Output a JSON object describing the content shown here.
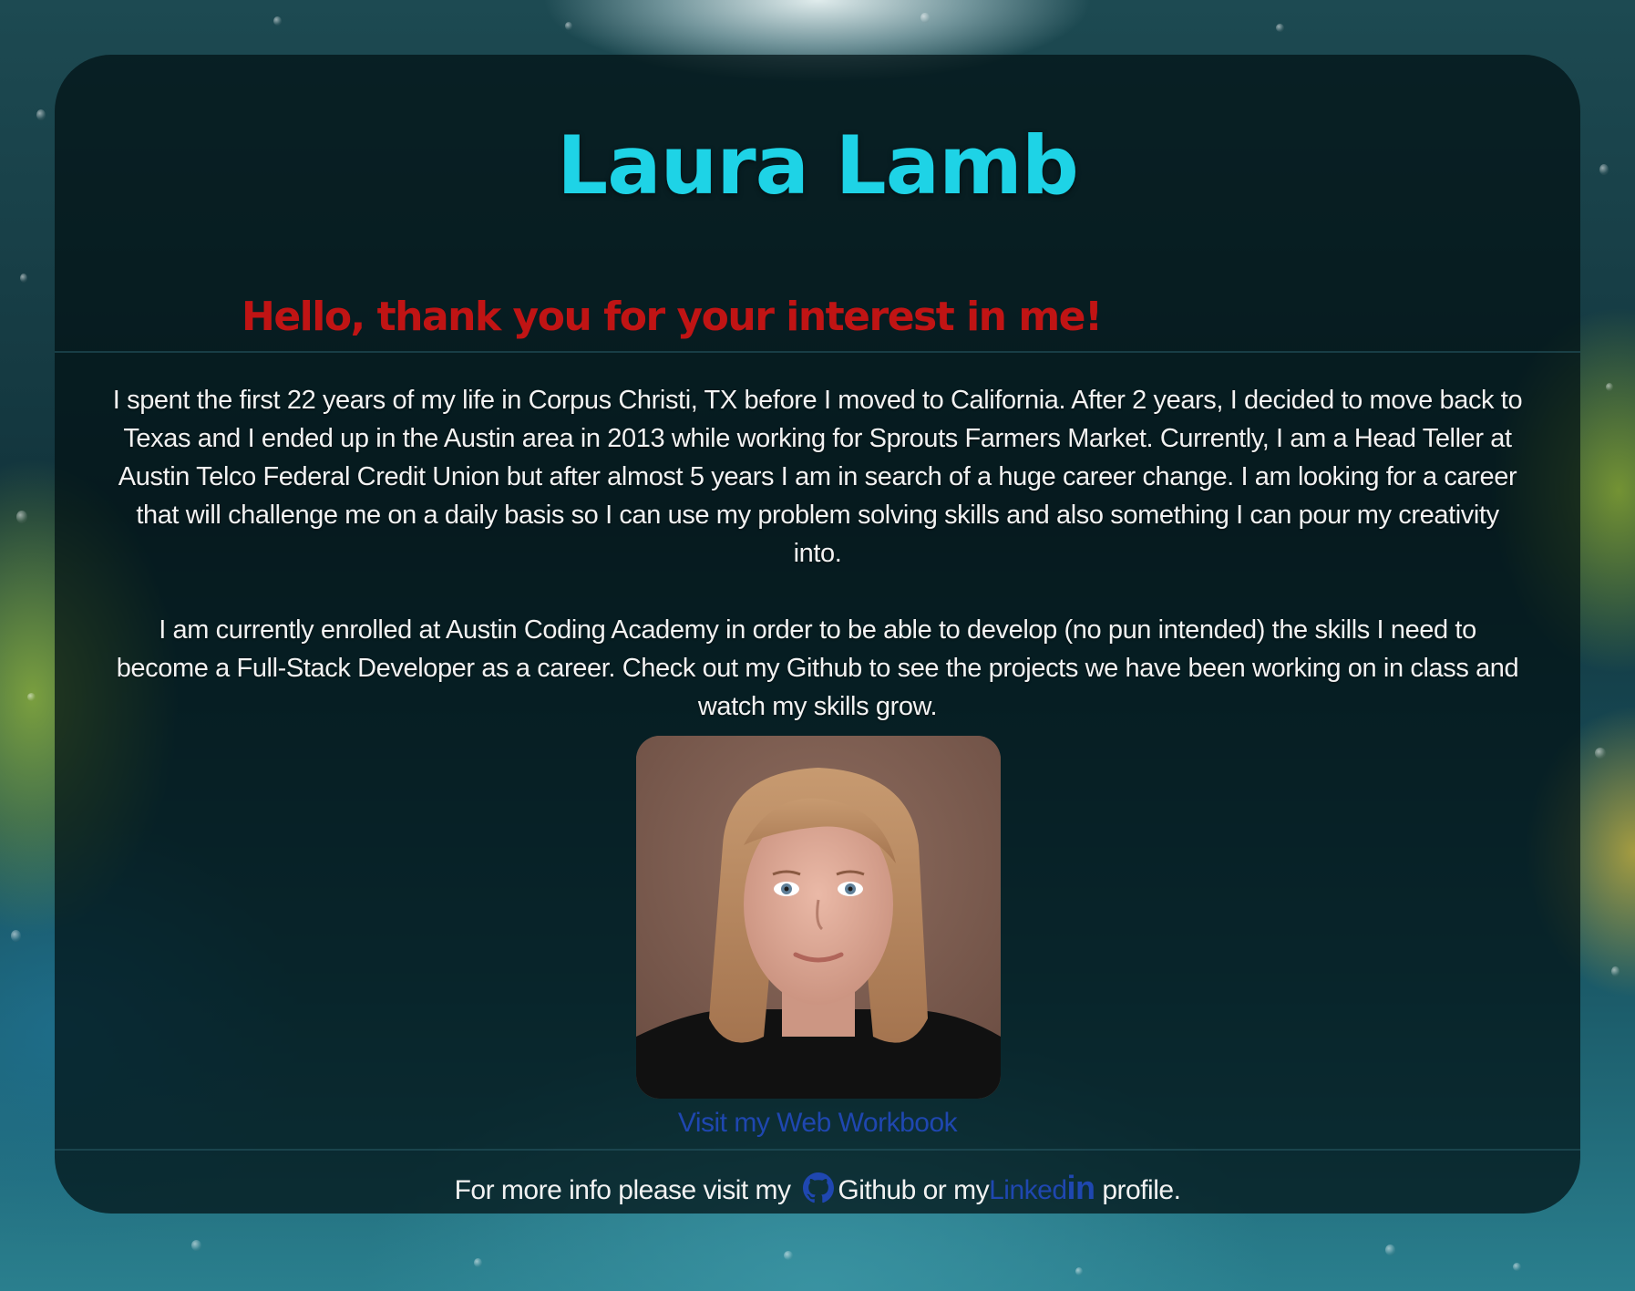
{
  "page": {
    "title": "Laura Lamb",
    "greeting": "Hello, thank you for your interest in me!",
    "bio_paragraph_1": "I spent the first 22 years of my life in Corpus Christi, TX before I moved to California. After 2 years, I decided to move back to Texas and I ended up in the Austin area in 2013 while working for Sprouts Farmers Market. Currently, I am a Head Teller at Austin Telco Federal Credit Union but after almost 5 years I am in search of a huge career change. I am looking for a career that will challenge me on a daily basis so I can use my problem solving skills and also something I can pour my creativity into.",
    "bio_paragraph_2": "I am currently enrolled at Austin Coding Academy in order to be able to develop (no pun intended) the skills I need to become a Full-Stack Developer as a career. Check out my Github to see the projects we have been working on in class and watch my skills grow.",
    "workbook_link": "Visit my Web Workbook"
  },
  "footer": {
    "prefix": "For more info please visit my",
    "github_icon": "github-octocat-icon",
    "github_label": "Github",
    "middle": "or my",
    "linkedin_label_part1": "Linked",
    "linkedin_label_part2": "in",
    "suffix": "profile."
  },
  "colors": {
    "title": "#1ed3e6",
    "greeting": "#c01414",
    "link": "#1f47b0",
    "body_text": "#f2f2f2"
  }
}
